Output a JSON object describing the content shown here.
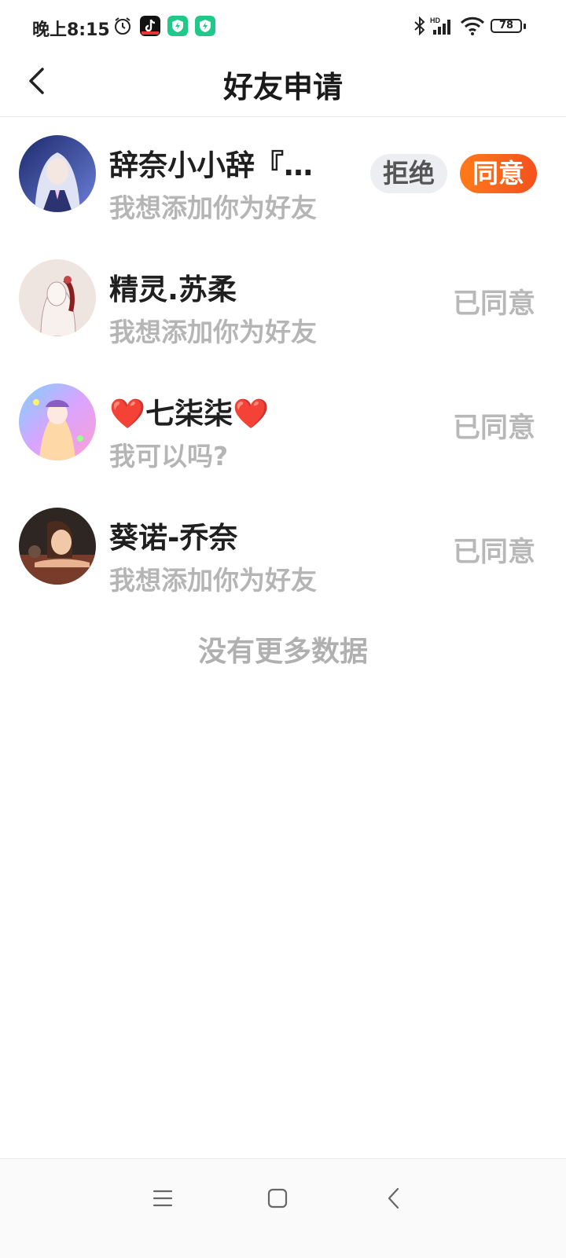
{
  "status_bar": {
    "time": "晚上8:15",
    "battery": "78",
    "icons": [
      "alarm-icon",
      "tiktok-icon",
      "shield-app-icon",
      "shield-app-icon",
      "bluetooth-icon",
      "hd-signal-icon",
      "wifi-icon",
      "battery-icon"
    ]
  },
  "header": {
    "title": "好友申请",
    "back_icon": "chevron-left-icon"
  },
  "requests": [
    {
      "name": "辞奈小小辞『…",
      "message": "我想添加你为好友",
      "status": "pending",
      "reject_label": "拒绝",
      "accept_label": "同意"
    },
    {
      "name": "精灵.苏柔",
      "message": "我想添加你为好友",
      "status": "已同意"
    },
    {
      "name": "❤️七柒柒❤️",
      "message": "我可以吗?",
      "status": "已同意"
    },
    {
      "name": "葵诺-乔奈",
      "message": "我想添加你为好友",
      "status": "已同意"
    }
  ],
  "footer_text": "没有更多数据",
  "nav_bar": {
    "icons": [
      "menu-icon",
      "home-square-icon",
      "back-icon"
    ]
  },
  "colors": {
    "accent": "#f4511e",
    "muted_text": "#b5b5b5",
    "reject_bg": "#eceef1"
  }
}
